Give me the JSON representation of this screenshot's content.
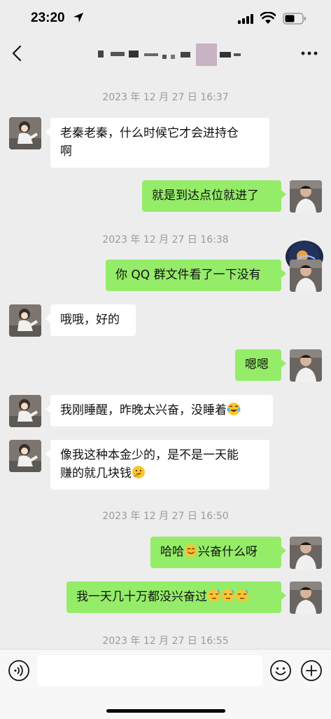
{
  "status_bar": {
    "time": "23:20"
  },
  "messages": [
    {
      "kind": "timestamp",
      "text": "2023 年 12 月 27 日 16:37"
    },
    {
      "kind": "in",
      "text": "老秦老秦，什么时候它才会进持仓\n啊"
    },
    {
      "kind": "out",
      "text": "就是到达点位就进了"
    },
    {
      "kind": "timestamp",
      "text": "2023 年 12 月 27 日 16:38"
    },
    {
      "kind": "out",
      "text": "你 QQ 群文件看了一下没有"
    },
    {
      "kind": "in",
      "text": "哦哦，好的"
    },
    {
      "kind": "out",
      "text": "嗯嗯"
    },
    {
      "kind": "in",
      "text": "我刚睡醒，昨晚太兴奋，没睡着",
      "emoji": "tears-of-joy-emoji"
    },
    {
      "kind": "in",
      "text": "像我这种本金少的，是不是一天能\n赚的就几块钱",
      "emoji": "thinking-emoji"
    },
    {
      "kind": "timestamp",
      "text": "2023 年 12 月 27 日 16:50"
    },
    {
      "kind": "out",
      "text_before": "哈哈",
      "emoji": "smile-emoji",
      "text_after": "兴奋什么呀"
    },
    {
      "kind": "out",
      "text": "我一天几十万都没兴奋过",
      "emoji": "sleepy-emoji",
      "emoji_count": 3
    },
    {
      "kind": "timestamp",
      "text": "2023 年 12 月 27 日 16:55"
    }
  ],
  "colors": {
    "out_bubble": "#95ec69",
    "in_bubble": "#ffffff",
    "background": "#ededed"
  },
  "icons": [
    "location-arrow-icon",
    "signal-icon",
    "wifi-icon",
    "battery-icon",
    "back-icon",
    "more-icon",
    "voice-icon",
    "emoji-icon",
    "plus-icon"
  ]
}
